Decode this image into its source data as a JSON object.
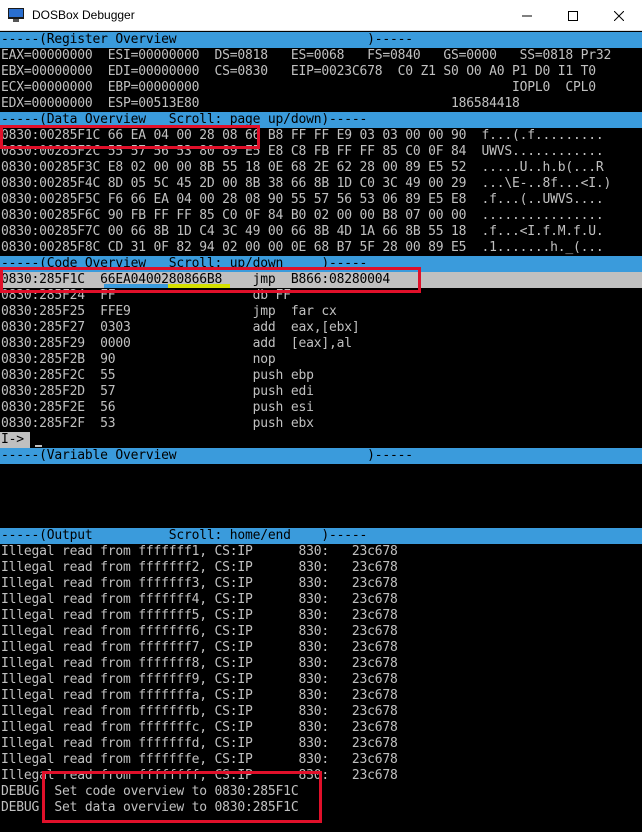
{
  "window": {
    "title": "DOSBox Debugger",
    "minimize_icon": "minimize-icon",
    "maximize_icon": "maximize-icon",
    "close_icon": "close-icon",
    "app_icon": "dosbox-app-icon"
  },
  "registers": {
    "header": "-----(Register Overview                         )-----",
    "lines": [
      "EAX=00000000  ESI=00000000  DS=0818   ES=0068   FS=0840   GS=0000   SS=0818 Pr32",
      "EBX=00000000  EDI=00000000  CS=0830   EIP=0023C678  C0 Z1 S0 O0 A0 P1 D0 I1 T0",
      "ECX=00000000  EBP=00000000                                         IOPL0  CPL0",
      "EDX=00000000  ESP=00513E80                                 186584418"
    ]
  },
  "data_overview": {
    "header": "-----(Data Overview   Scroll: page up/down)-----",
    "lines": [
      "0830:00285F1C 66 EA 04 00 28 08 66 B8 FF FF E9 03 03 00 00 90  f...(.f.........",
      "0830:00285F2C 55 57 56 53 80 89 E5 E8 C8 FB FF FF 85 C0 0F 84  UWVS............",
      "0830:00285F3C E8 02 00 00 8B 55 18 0E 68 2E 62 28 00 89 E5 52  .....U..h.b(...R",
      "0830:00285F4C 8D 05 5C 45 2D 00 8B 38 66 8B 1D C0 3C 49 00 29  ...\\E-..8f...<I.)",
      "0830:00285F5C F6 66 EA 04 00 28 08 90 55 57 56 53 06 89 E5 E8  .f...(..UWVS....",
      "0830:00285F6C 90 FB FF FF 85 C0 0F 84 B0 02 00 00 B8 07 00 00  ................",
      "0830:00285F7C 00 66 8B 1D C4 3C 49 00 66 8B 4D 1A 66 8B 55 18  .f...<I.f.M.f.U.",
      "0830:00285F8C CD 31 0F 82 94 02 00 00 0E 68 B7 5F 28 00 89 E5  .1.......h._(..."
    ]
  },
  "code_overview": {
    "header": "-----(Code Overview   Scroll: up/down     )-----",
    "current": "0830:285F1C  66EA0400280866B8    jmp  B866:08280004",
    "lines": [
      "0830:285F24  FF                  db FF",
      "0830:285F25  FFE9                jmp  far cx",
      "0830:285F27  0303                add  eax,[ebx]",
      "0830:285F29  0000                add  [eax],al",
      "0830:285F2B  90                  nop",
      "0830:285F2C  55                  push ebp",
      "0830:285F2D  57                  push edi",
      "0830:285F2E  56                  push esi",
      "0830:285F2F  53                  push ebx"
    ],
    "underline_colors": {
      "blue": "#3a9bdc",
      "yellow": "#d4e000"
    }
  },
  "command": {
    "prompt": "I->",
    "value": ""
  },
  "variables": {
    "header": "-----(Variable Overview                         )-----"
  },
  "output": {
    "header": "-----(Output          Scroll: home/end    )-----",
    "lines": [
      "Illegal read from fffffff1, CS:IP      830:   23c678",
      "Illegal read from fffffff2, CS:IP      830:   23c678",
      "Illegal read from fffffff3, CS:IP      830:   23c678",
      "Illegal read from fffffff4, CS:IP      830:   23c678",
      "Illegal read from fffffff5, CS:IP      830:   23c678",
      "Illegal read from fffffff6, CS:IP      830:   23c678",
      "Illegal read from fffffff7, CS:IP      830:   23c678",
      "Illegal read from fffffff8, CS:IP      830:   23c678",
      "Illegal read from fffffff9, CS:IP      830:   23c678",
      "Illegal read from fffffffa, CS:IP      830:   23c678",
      "Illegal read from fffffffb, CS:IP      830:   23c678",
      "Illegal read from fffffffc, CS:IP      830:   23c678",
      "Illegal read from fffffffd, CS:IP      830:   23c678",
      "Illegal read from fffffffe, CS:IP      830:   23c678",
      "Illegal read from ffffffff, CS:IP      830:   23c678",
      "DEBUG: Set code overview to 0830:285F1C",
      "DEBUG: Set data overview to 0830:285F1C"
    ]
  },
  "colors": {
    "background": "#000000",
    "text": "#c0c0c0",
    "header_bar": "#3a9bdc",
    "highlight": "#c0c0c0",
    "annotation_red": "#e0102a"
  }
}
